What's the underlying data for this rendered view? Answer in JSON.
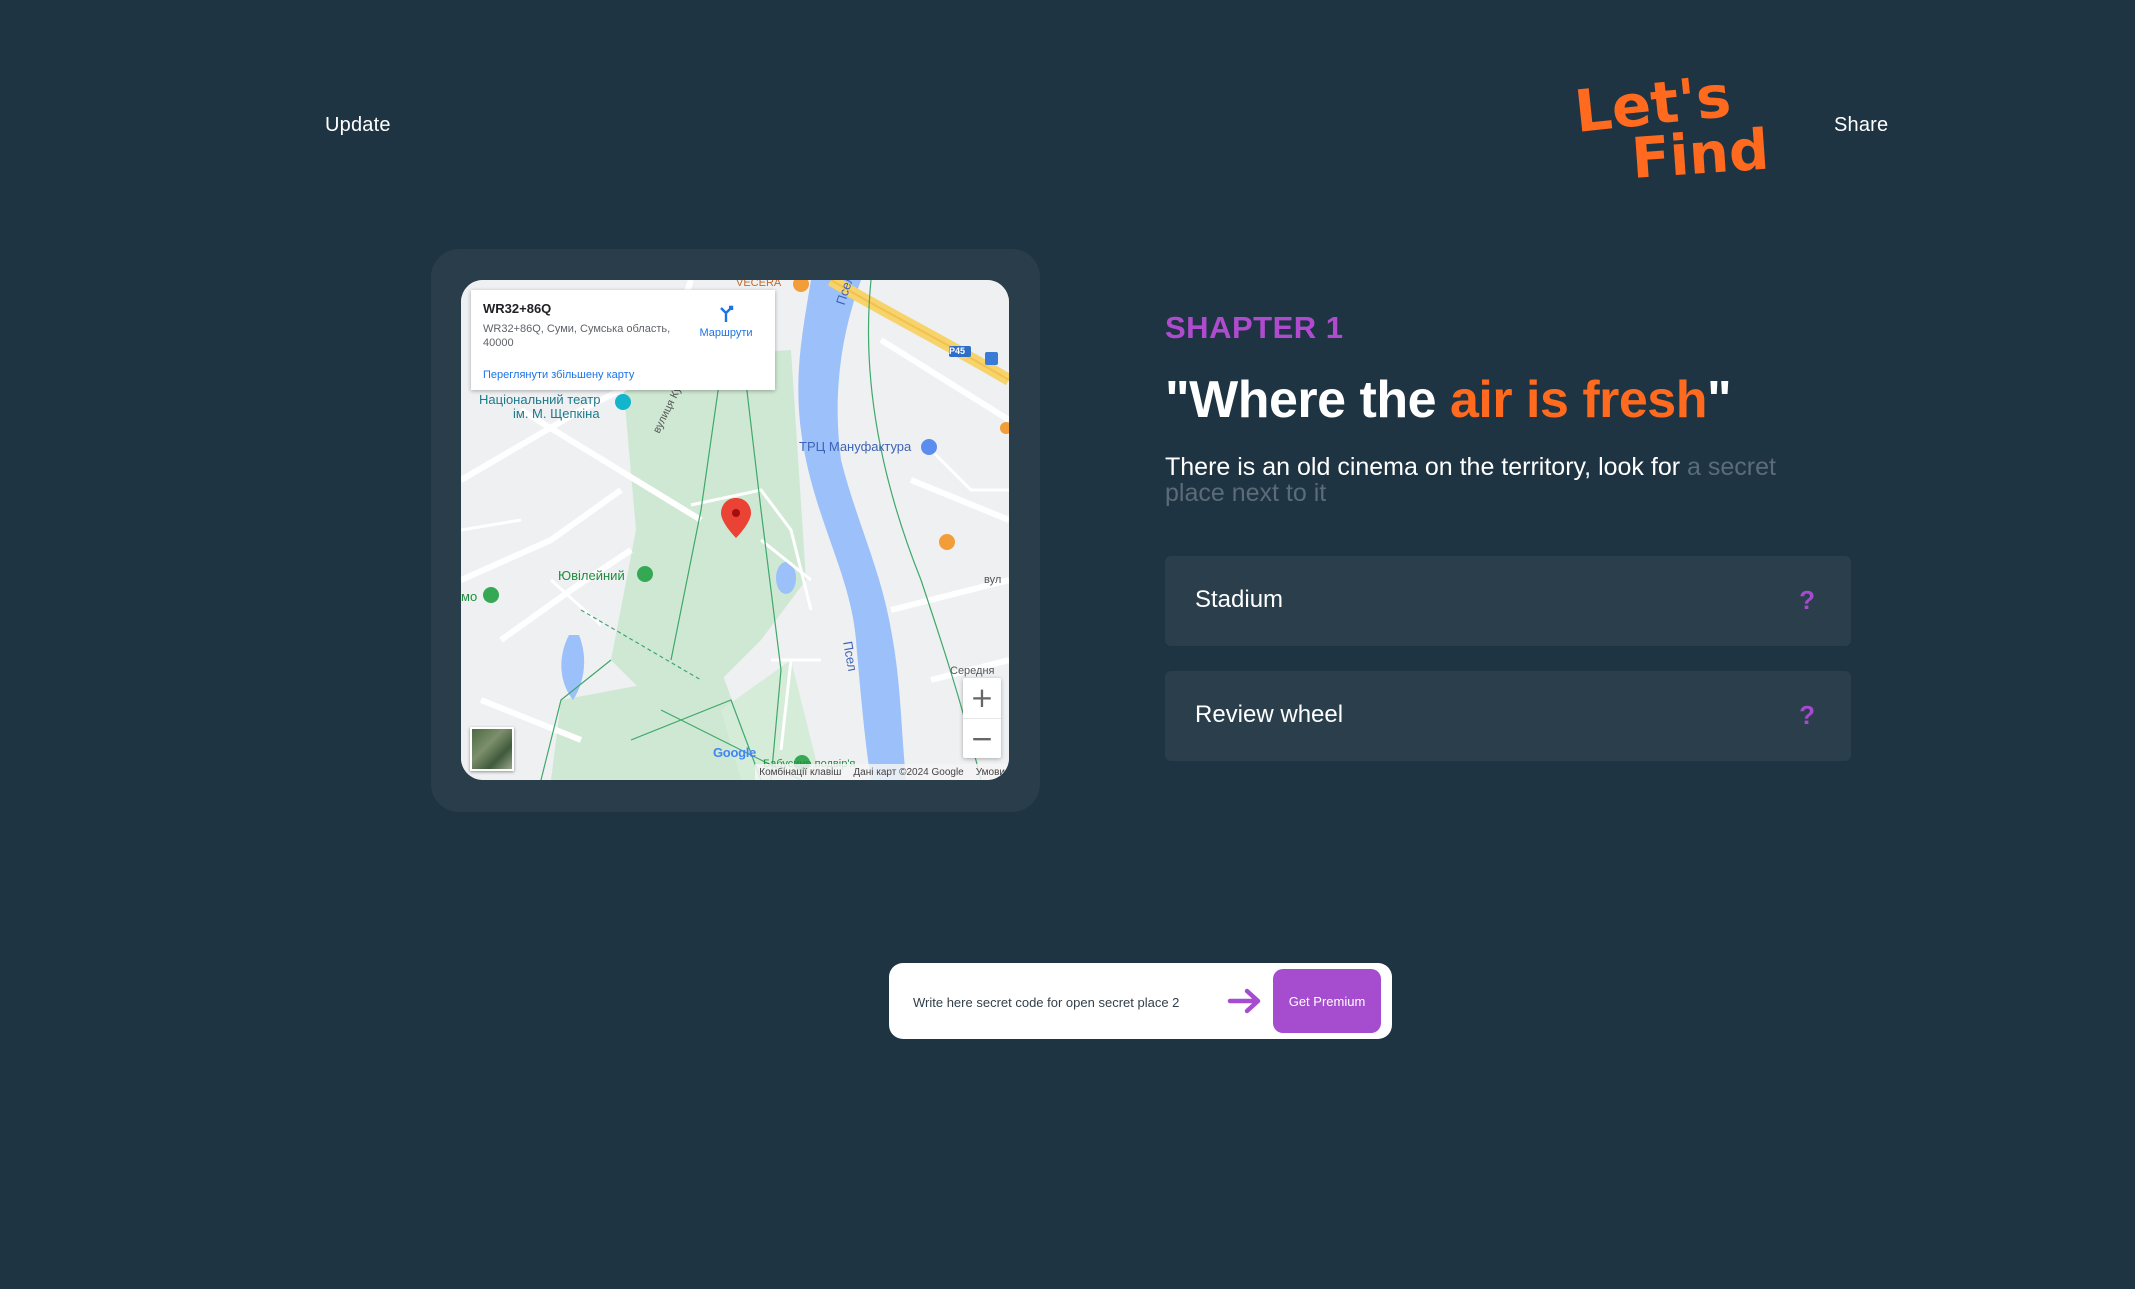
{
  "nav": {
    "update_label": "Update",
    "share_label": "Share"
  },
  "logo": {
    "text_line1": "Let's",
    "text_line2": "Find",
    "color": "#ff6a1f"
  },
  "map": {
    "info": {
      "code": "WR32+86Q",
      "address": "WR32+86Q, Суми, Сумська область, 40000",
      "view_bigger_link": "Переглянути збільшену карту",
      "routes_label": "Маршрути"
    },
    "labels": {
      "theatre": "Національний театр",
      "theatre_2": "ім. М. Щепкіна",
      "street": "вулиця Кус",
      "mall": "ТРЦ Мануфактура",
      "yuvileinyi": "Ювілейний",
      "river_1": "Псел",
      "river_2": "Псел",
      "road_badge": "P45",
      "mo": "мо",
      "vul": "вул",
      "serednia": "Середня",
      "bottom_place": "Бабусине подвір'я",
      "top_place": "VECERA"
    },
    "zoom_in": "+",
    "zoom_out": "−",
    "footer": {
      "shortcuts": "Комбінації клавіш",
      "data": "Дані карт ©2024 Google",
      "terms": "Умови"
    },
    "google": "Google"
  },
  "chapter": {
    "label": "SHAPTER 1",
    "title_pre": "\"Where the ",
    "title_highlight": "air is fresh",
    "title_post": "\"",
    "description": "There is an old cinema on the territory, look for ",
    "description_faded": "a secret place next to it"
  },
  "hints": [
    {
      "label": "Stadium",
      "mark": "?"
    },
    {
      "label": "Review wheel",
      "mark": "?"
    }
  ],
  "code_bar": {
    "placeholder": "Write here secret code for open secret place 2",
    "button_label": "Get Premium"
  },
  "colors": {
    "background": "#1f3442",
    "accent_orange": "#ff6a1f",
    "accent_purple": "#a54ccf"
  }
}
